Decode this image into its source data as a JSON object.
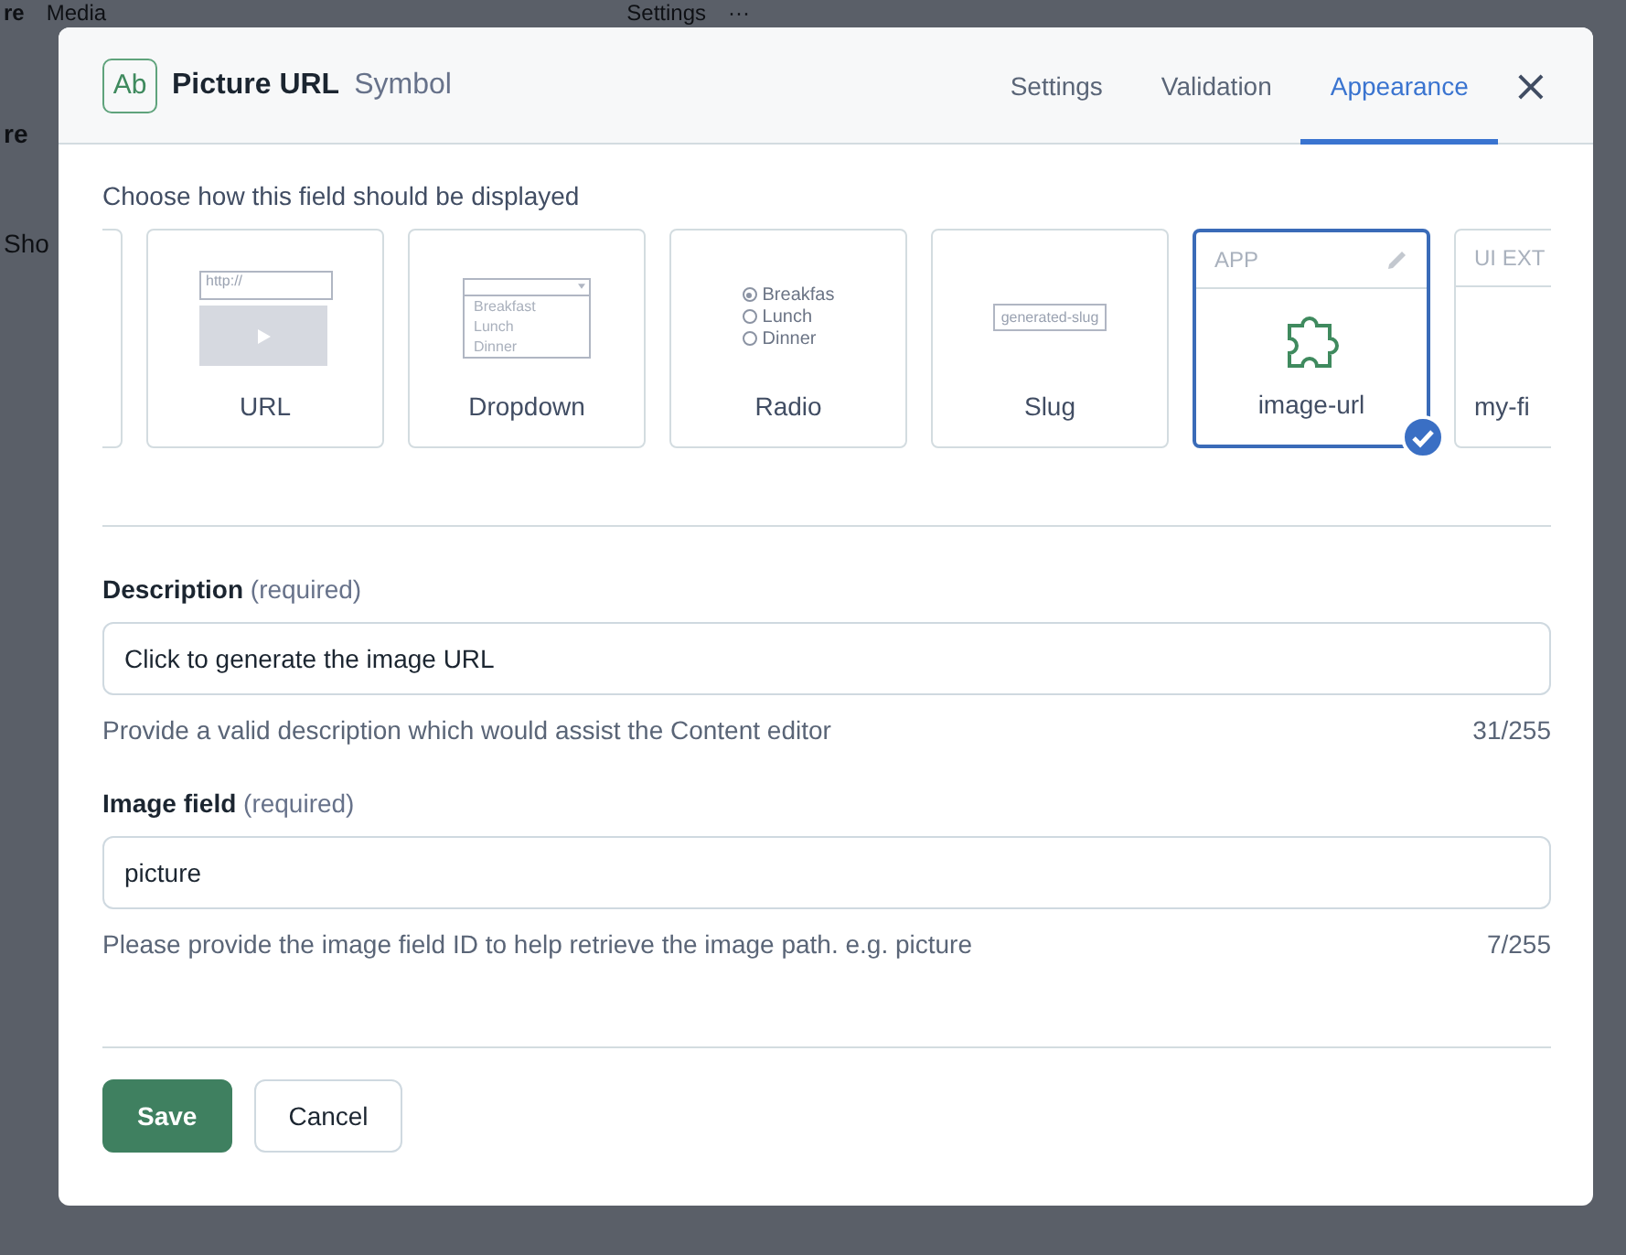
{
  "background": {
    "top_texts": [
      {
        "text": "re",
        "bold": true
      },
      {
        "text": "Media",
        "bold": false
      }
    ],
    "top_right": [
      "Settings",
      "···"
    ],
    "rows": [
      {
        "text": "re",
        "bold": true
      },
      {
        "text": "Sho",
        "bold": false
      }
    ]
  },
  "dialog": {
    "icon_text": "Ab",
    "title": "Picture URL",
    "type": "Symbol",
    "tabs": [
      {
        "label": "Settings",
        "selected": false
      },
      {
        "label": "Validation",
        "selected": false
      },
      {
        "label": "Appearance",
        "selected": true
      }
    ],
    "close": "×"
  },
  "appearance": {
    "prompt": "Choose how this field should be displayed",
    "cards": [
      {
        "kind": "blank",
        "selected": false
      },
      {
        "kind": "url",
        "label": "URL",
        "preview": [
          "http://"
        ],
        "selected": false
      },
      {
        "kind": "dropdown",
        "label": "Dropdown",
        "preview": [
          "Breakfast",
          "Lunch",
          "Dinner"
        ],
        "selected": false
      },
      {
        "kind": "radio",
        "label": "Radio",
        "options": [
          {
            "text": "Breakfas",
            "selected": true
          },
          {
            "text": "Lunch",
            "selected": false
          },
          {
            "text": "Dinner",
            "selected": false
          }
        ],
        "selected": false
      },
      {
        "kind": "slug",
        "label": "Slug",
        "preview": [
          "generated-slug"
        ],
        "selected": false
      },
      {
        "kind": "app",
        "header": "APP",
        "label": "image-url",
        "selected": true
      },
      {
        "kind": "extension",
        "header": "UI EXT",
        "label": "my-fi",
        "selected": false
      }
    ]
  },
  "fields": [
    {
      "label": "Description",
      "hint": "(required)",
      "value": "Click to generate the image URL",
      "help": "Provide a valid description which would assist the Content editor",
      "count": "31/255"
    },
    {
      "label": "Image field",
      "hint": "(required)",
      "value": "picture",
      "help": "Please provide the image field ID to help retrieve the image path. e.g. picture",
      "count": "7/255"
    }
  ],
  "buttons": [
    {
      "label": "Save",
      "kind": "primary"
    },
    {
      "label": "Cancel",
      "kind": "secondary"
    }
  ]
}
